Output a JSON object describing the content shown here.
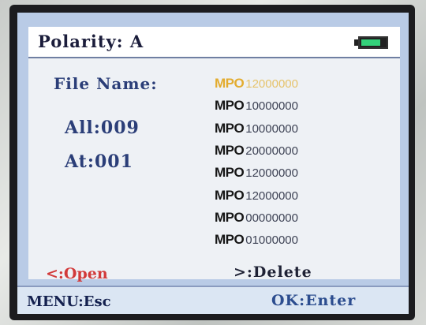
{
  "colors": {
    "screen_bg": "#b9cbe6",
    "label_blue": "#2b3e78",
    "selected_gold": "#e3ac2f",
    "open_red": "#d23a3a",
    "battery_green": "#33d17a"
  },
  "header": {
    "title": "Polarity: A",
    "battery_icon": "battery-icon",
    "battery_level": 0.8
  },
  "info": {
    "file_name_label": "File Name:",
    "all_label": "All:009",
    "at_label": "At:001"
  },
  "files": [
    {
      "prefix": "MPO",
      "number": "12000000",
      "selected": true
    },
    {
      "prefix": "MPO",
      "number": "10000000",
      "selected": false
    },
    {
      "prefix": "MPO",
      "number": "10000000",
      "selected": false
    },
    {
      "prefix": "MPO",
      "number": "20000000",
      "selected": false
    },
    {
      "prefix": "MPO",
      "number": "12000000",
      "selected": false
    },
    {
      "prefix": "MPO",
      "number": "12000000",
      "selected": false
    },
    {
      "prefix": "MPO",
      "number": "00000000",
      "selected": false
    },
    {
      "prefix": "MPO",
      "number": "01000000",
      "selected": false
    }
  ],
  "actions": {
    "open": "<:Open",
    "delete": ">:Delete"
  },
  "footer": {
    "menu": "MENU:Esc",
    "ok": "OK:Enter"
  }
}
